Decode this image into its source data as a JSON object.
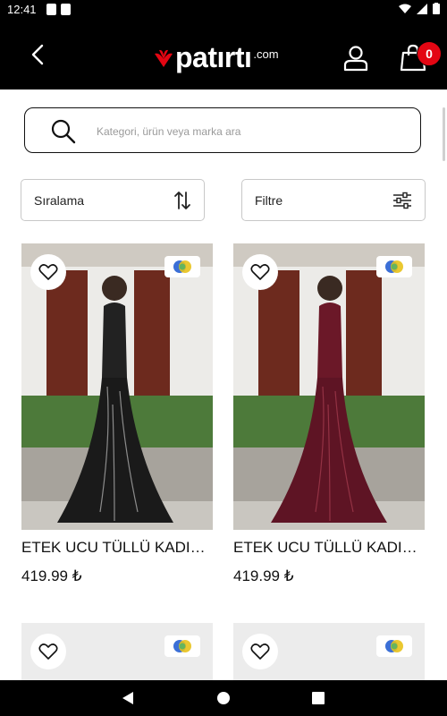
{
  "status_bar": {
    "time": "12:41"
  },
  "header": {
    "logo_text": "patırtı",
    "logo_suffix": ".com",
    "cart_count": "0"
  },
  "search": {
    "placeholder": "Kategori, ürün veya marka ara"
  },
  "controls": {
    "sort_label": "Sıralama",
    "filter_label": "Filtre"
  },
  "products": [
    {
      "name": "ETEK UCU TÜLLÜ KADIN…",
      "price": "419.99 ₺",
      "dress_color": "#1a1a1a"
    },
    {
      "name": "ETEK UCU TÜLLÜ KADIN…",
      "price": "419.99 ₺",
      "dress_color": "#5e1424"
    }
  ],
  "colors": {
    "brand_red": "#e30613",
    "header_bg": "#000000"
  }
}
